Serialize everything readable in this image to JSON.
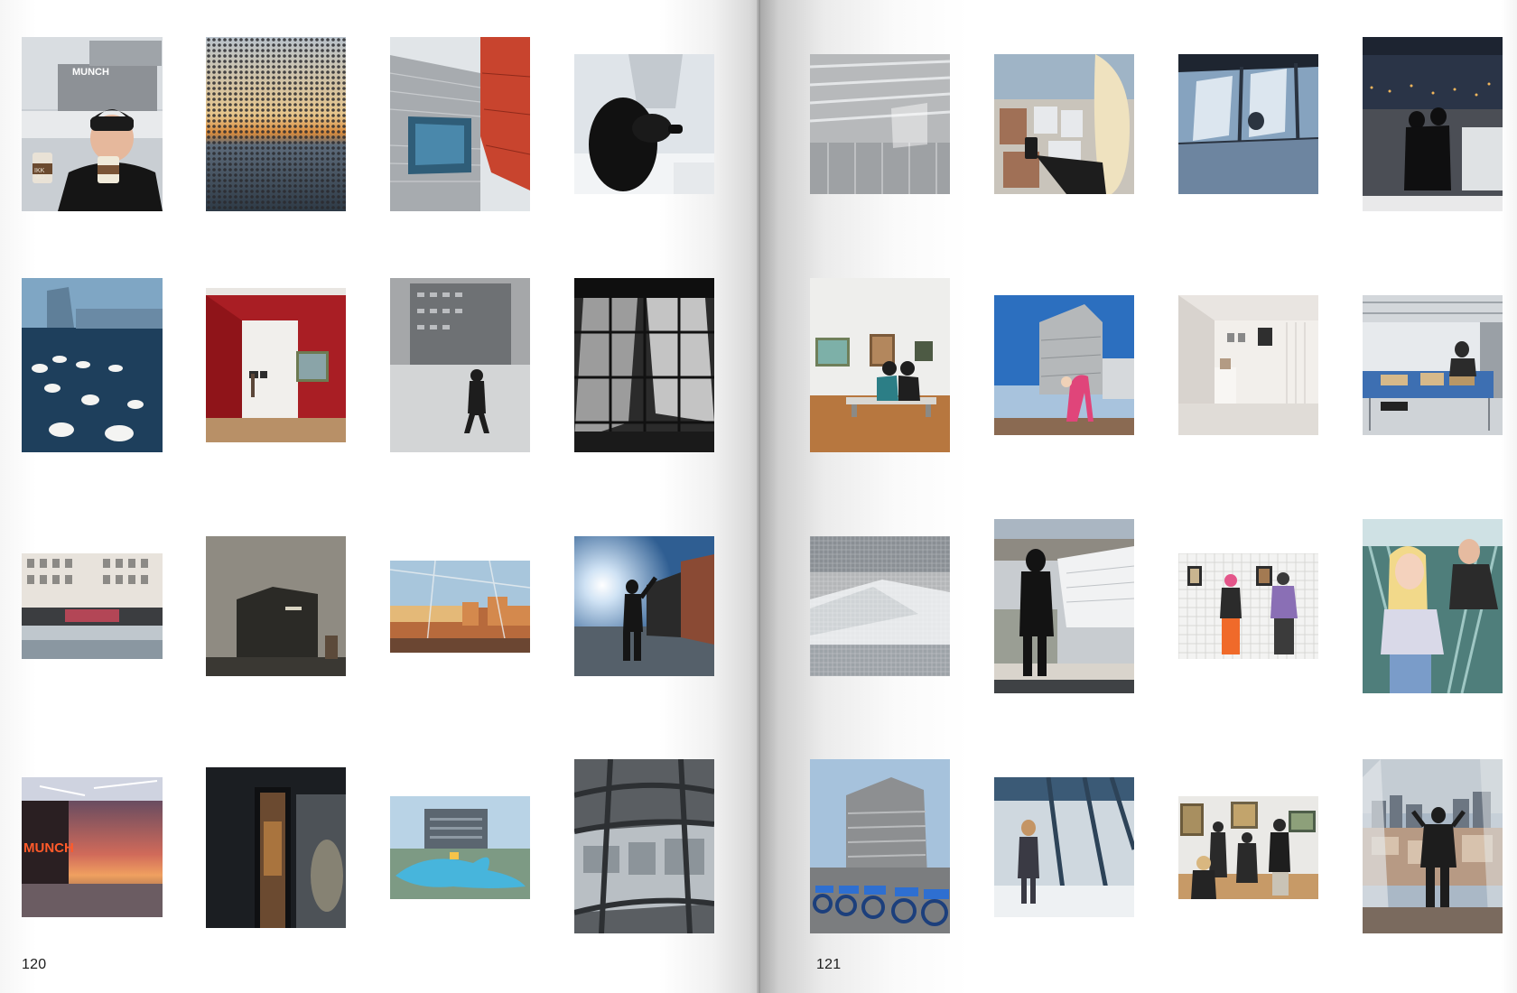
{
  "spread": {
    "left_page": {
      "page_number": "120",
      "photos": [
        {
          "name": "woman-with-coffee-munch-photo",
          "sign_text": "MUNCH",
          "cup_text": "IKK\nMO"
        },
        {
          "name": "perforated-facade-sunset-photo"
        },
        {
          "name": "facade-window-balcony-photo"
        },
        {
          "name": "black-poodle-snow-photo"
        },
        {
          "name": "swans-fjord-photo"
        },
        {
          "name": "red-gallery-room-photo"
        },
        {
          "name": "foggy-museum-walker-photo"
        },
        {
          "name": "glass-atrium-bw-photo"
        },
        {
          "name": "graffiti-waterfront-building-photo"
        },
        {
          "name": "dark-museum-tower-photo"
        },
        {
          "name": "window-city-view-photo"
        },
        {
          "name": "silhouette-sun-flare-photo"
        },
        {
          "name": "munch-neon-sunset-photo",
          "sign_text": "MUNCH"
        },
        {
          "name": "dark-doorway-artwork-photo"
        },
        {
          "name": "inflatable-blue-dolphin-photo"
        },
        {
          "name": "window-grid-harbour-photo"
        }
      ]
    },
    "right_page": {
      "page_number": "121",
      "photos": [
        {
          "name": "louvre-facade-detail-photo"
        },
        {
          "name": "phone-photo-city-view-photo"
        },
        {
          "name": "window-shadows-photo"
        },
        {
          "name": "couple-night-window-photo"
        },
        {
          "name": "couple-bench-gallery-photo"
        },
        {
          "name": "stretching-woman-terrace-photo"
        },
        {
          "name": "white-gallery-pedestal-photo"
        },
        {
          "name": "conservation-studio-photo"
        },
        {
          "name": "opera-house-through-mesh-photo"
        },
        {
          "name": "person-overlooking-city-photo"
        },
        {
          "name": "gallery-visitors-tiles-photo"
        },
        {
          "name": "escalator-selfie-photo"
        },
        {
          "name": "museum-bikes-photo"
        },
        {
          "name": "woman-at-window-photo"
        },
        {
          "name": "visitors-viewing-paintings-photo"
        },
        {
          "name": "man-on-rooftop-view-photo"
        }
      ]
    }
  }
}
